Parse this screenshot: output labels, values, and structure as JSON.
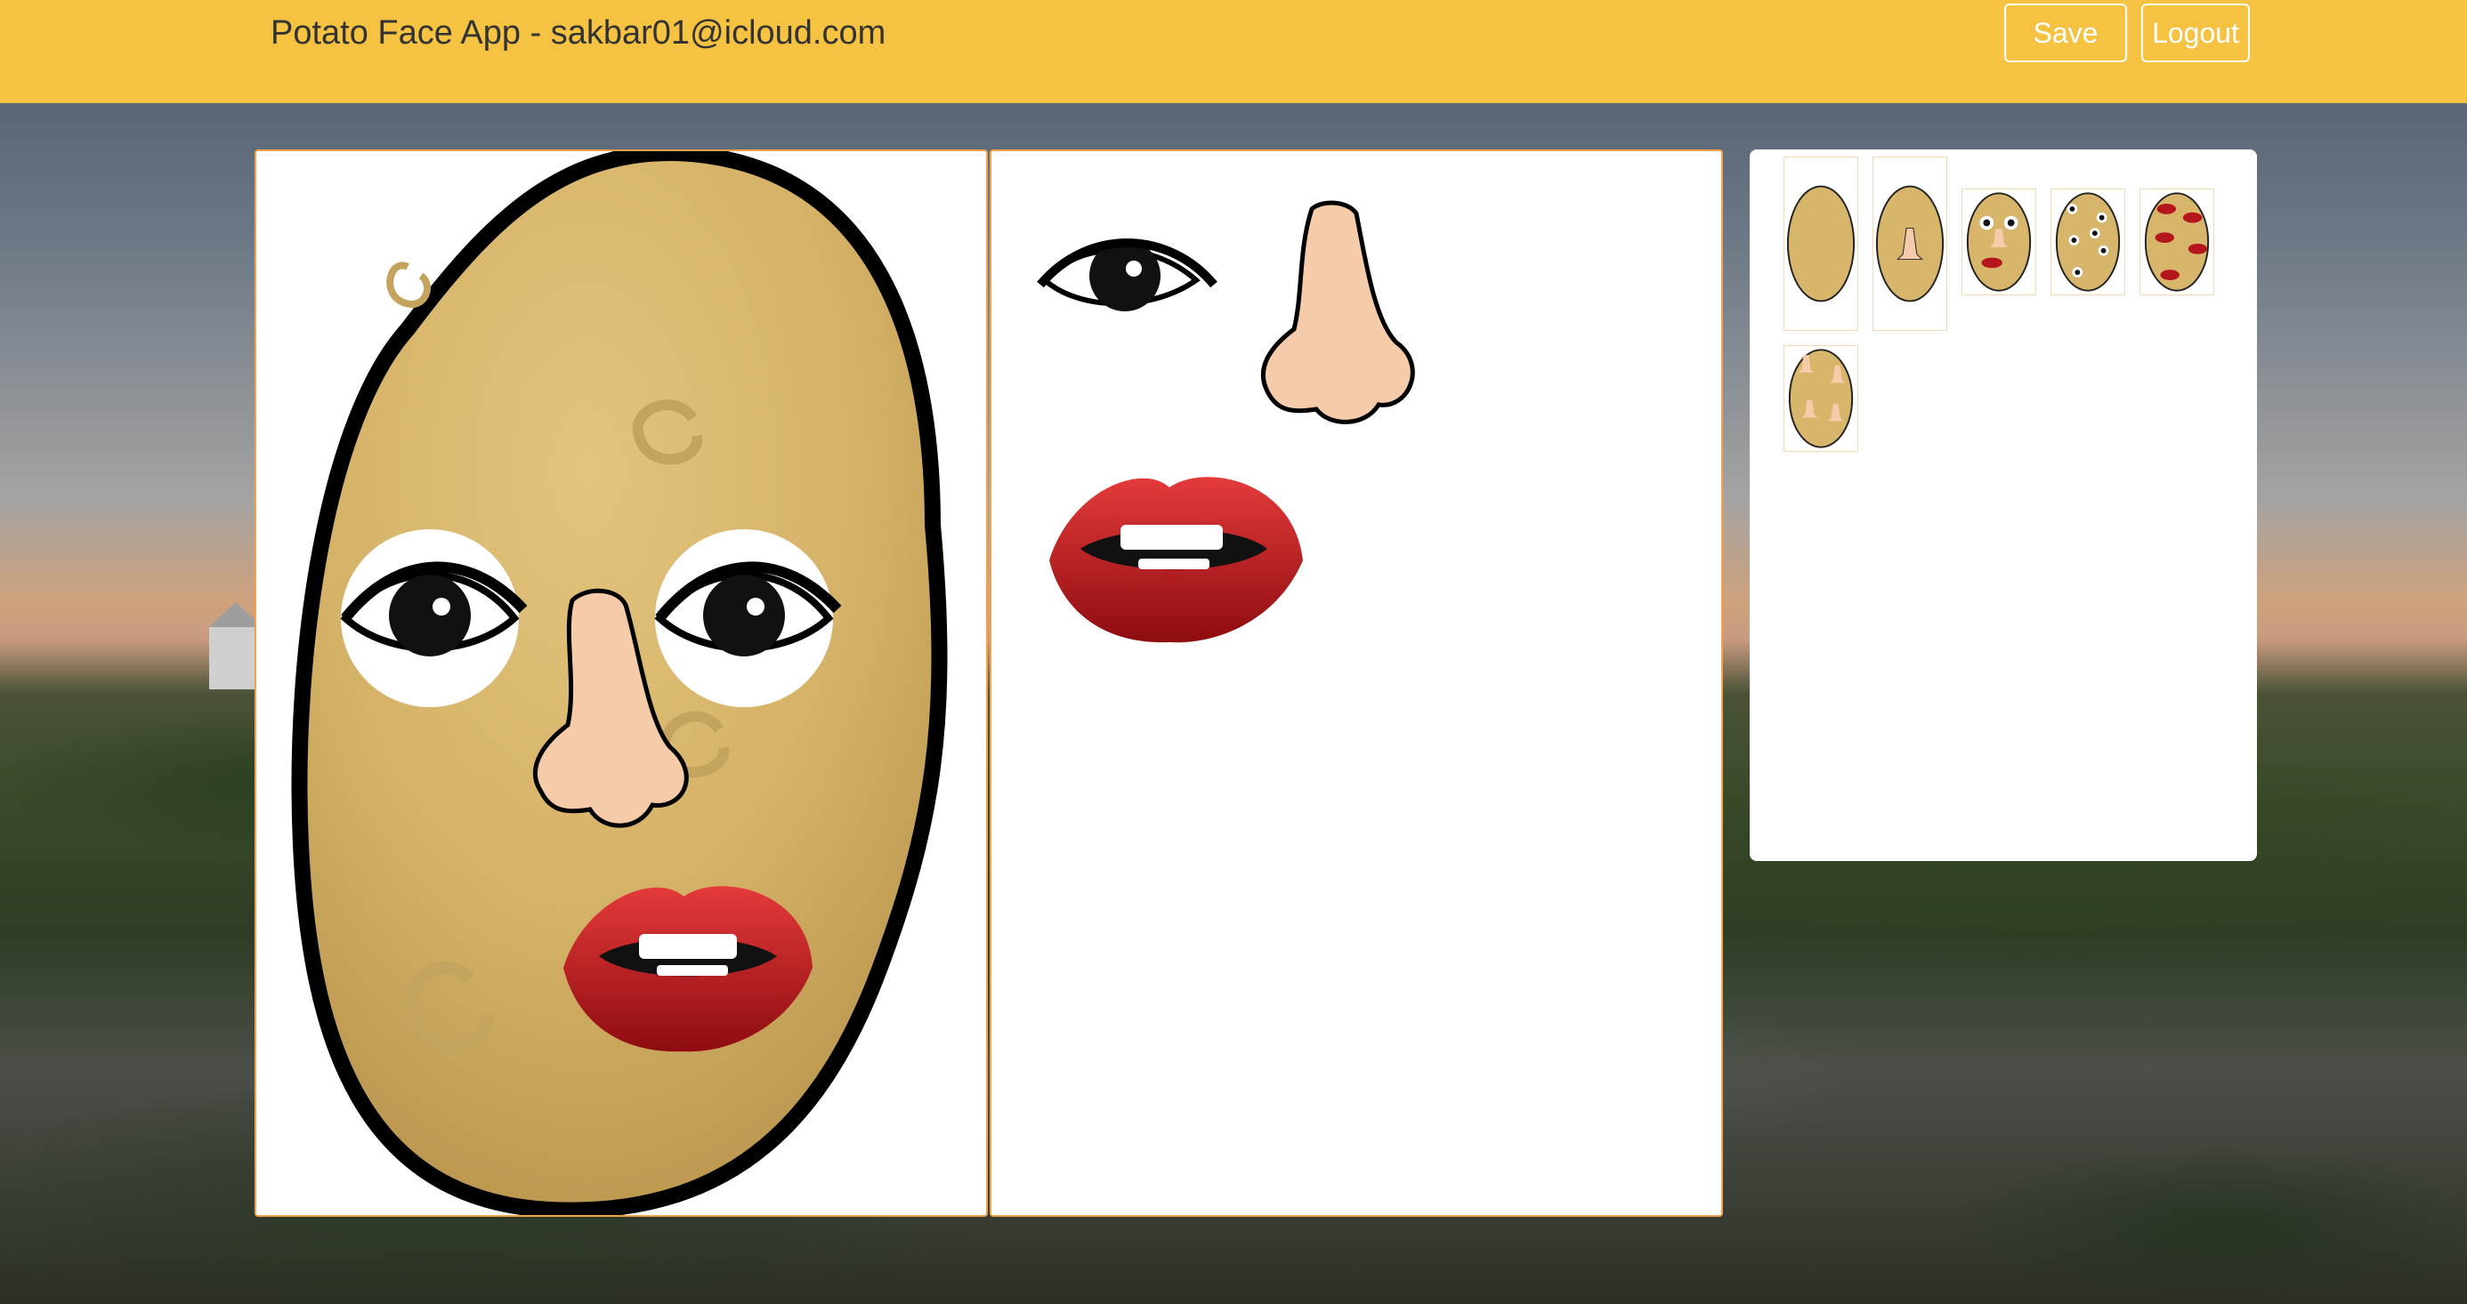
{
  "header": {
    "title": "Potato Face App - sakbar01@icloud.com",
    "save_label": "Save",
    "logout_label": "Logout"
  },
  "colors": {
    "header_bg": "#f5c242",
    "panel_border": "#f0a34c",
    "potato": "#d9b76a",
    "potato_outline": "#000000",
    "lips": "#b4161b",
    "nose": "#f6cba9"
  },
  "canvas": {
    "parts_placed": [
      "eye-left",
      "eye-right",
      "nose",
      "lips"
    ]
  },
  "parts_palette": {
    "items": [
      "eye",
      "nose",
      "lips"
    ]
  },
  "gallery": {
    "thumbnails": [
      {
        "name": "plain-potato",
        "parts": []
      },
      {
        "name": "potato-with-nose",
        "parts": [
          "nose"
        ]
      },
      {
        "name": "potato-eyes-nose-lips",
        "parts": [
          "eye",
          "eye",
          "nose",
          "lips"
        ]
      },
      {
        "name": "potato-many-eyes",
        "parts": [
          "eye",
          "eye",
          "eye",
          "eye",
          "eye",
          "eye"
        ]
      },
      {
        "name": "potato-many-lips",
        "parts": [
          "lips",
          "lips",
          "lips",
          "lips",
          "lips"
        ]
      },
      {
        "name": "potato-many-noses",
        "parts": [
          "nose",
          "nose",
          "nose",
          "nose"
        ]
      }
    ]
  }
}
